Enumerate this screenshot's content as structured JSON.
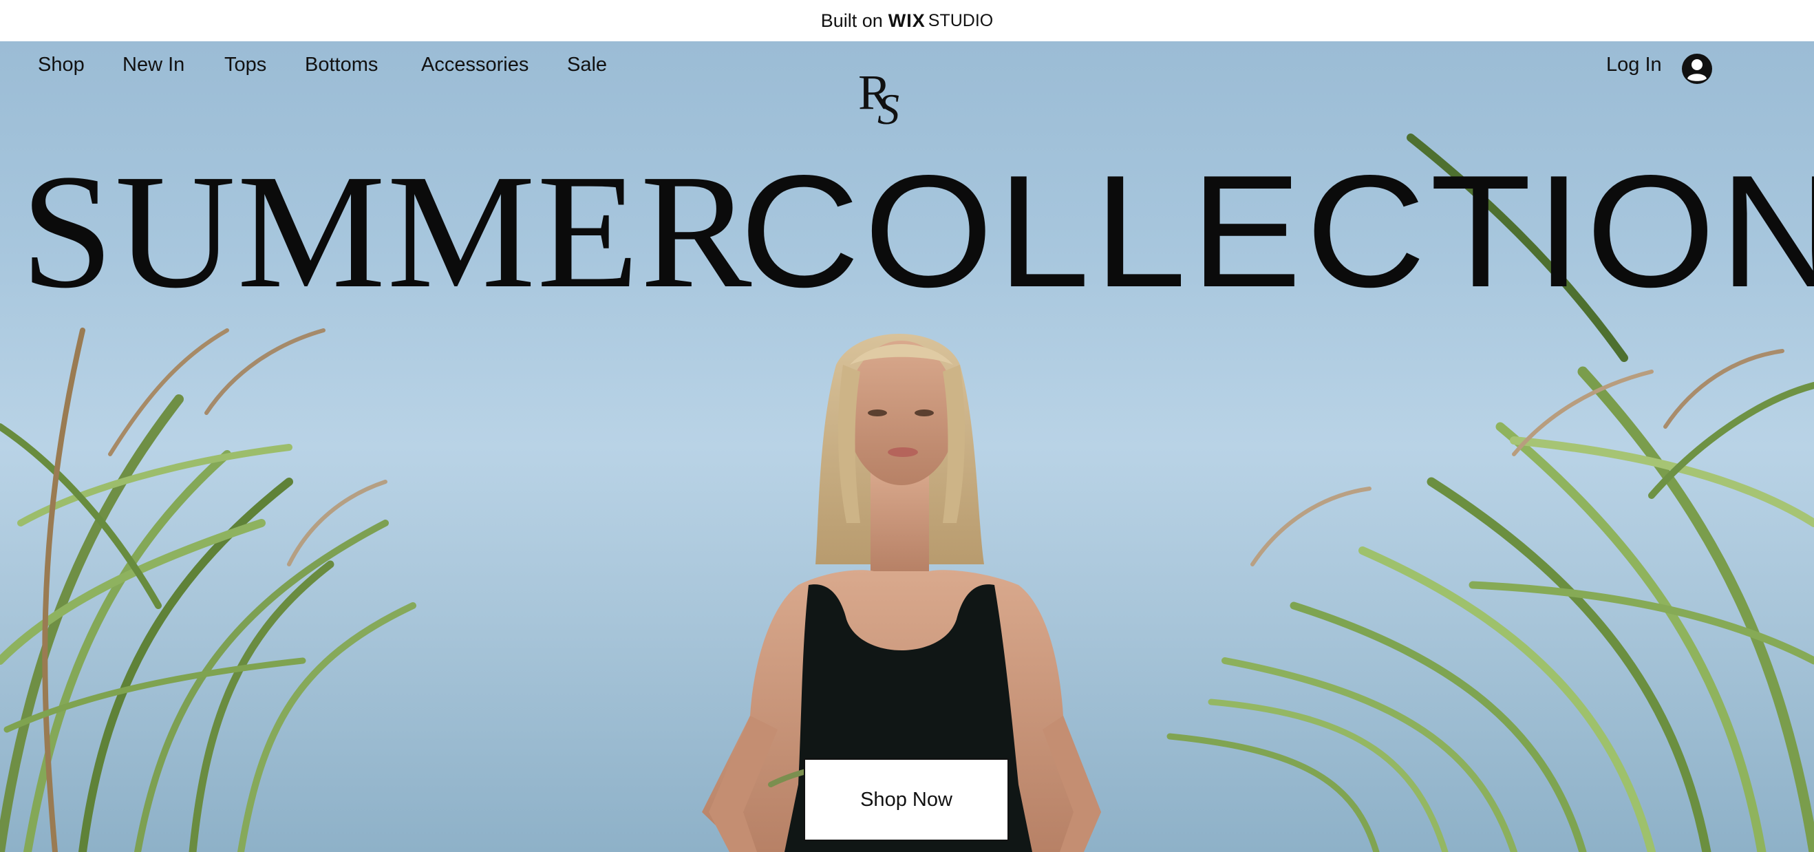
{
  "banner": {
    "prefix": "Built on",
    "brand_bold": "WIX",
    "brand_light": "STUDIO"
  },
  "nav": {
    "items": [
      {
        "label": "Shop"
      },
      {
        "label": "New In"
      },
      {
        "label": "Tops"
      },
      {
        "label": "Bottoms"
      },
      {
        "label": "Accessories"
      },
      {
        "label": "Sale"
      }
    ],
    "logo_text": "RS",
    "login_label": "Log In",
    "avatar_icon": "user-icon"
  },
  "hero": {
    "headline_serif": "SUMMER",
    "headline_sans": "COLLECTION",
    "cta_label": "Shop Now"
  },
  "colors": {
    "sky": "#a7c6dd",
    "text": "#111111",
    "button_bg": "#ffffff"
  }
}
